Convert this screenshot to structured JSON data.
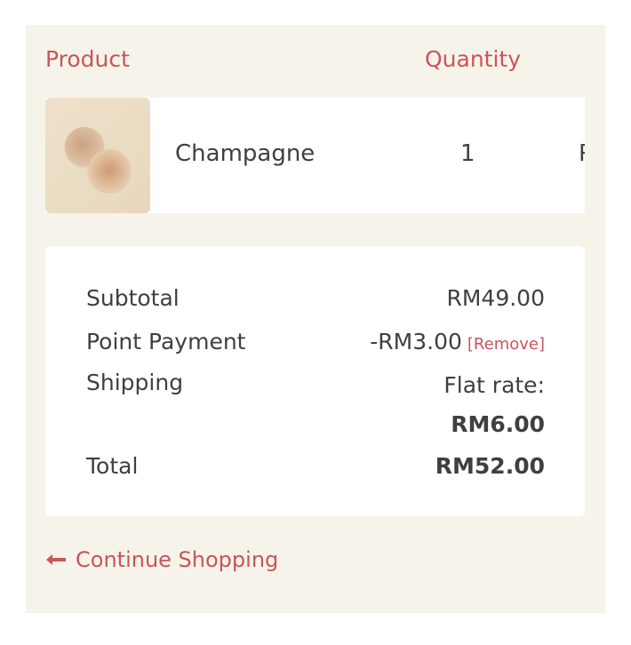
{
  "table_header": {
    "product": "Product",
    "quantity": "Quantity"
  },
  "cart_item": {
    "name": "Champagne",
    "quantity": "1",
    "price_partial": "R"
  },
  "summary": {
    "subtotal_label": "Subtotal",
    "subtotal_value": "RM49.00",
    "point_payment_label": "Point Payment",
    "point_payment_value": "-RM3.00",
    "remove_label": "[Remove]",
    "shipping_label": "Shipping",
    "shipping_method": "Flat rate:",
    "shipping_value": "RM6.00",
    "total_label": "Total",
    "total_value": "RM52.00"
  },
  "continue_shopping": "Continue Shopping",
  "colors": {
    "accent": "#c9555a",
    "panel_bg": "#f6f3ea",
    "text": "#3f3f3f"
  },
  "icons": {
    "continue": "arrow-left-icon"
  }
}
